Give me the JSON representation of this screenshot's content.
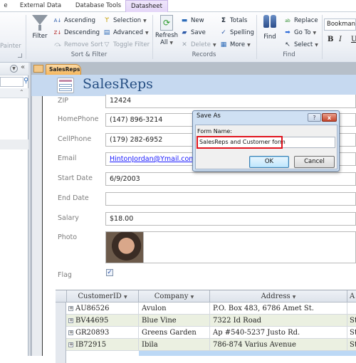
{
  "ribbon_tabs": [
    {
      "label": "e",
      "active": false
    },
    {
      "label": "External Data",
      "active": false
    },
    {
      "label": "Database Tools",
      "active": false
    },
    {
      "label": "Datasheet",
      "active": true
    }
  ],
  "ribbon": {
    "clipboard": {
      "painter": "Painter"
    },
    "sort_filter": {
      "label": "Sort & Filter",
      "filter": "Filter",
      "ascending": "Ascending",
      "descending": "Descending",
      "remove_sort": "Remove Sort",
      "selection": "Selection",
      "advanced": "Advanced",
      "toggle_filter": "Toggle Filter"
    },
    "records": {
      "label": "Records",
      "refresh": "Refresh",
      "refresh_all": "All",
      "new": "New",
      "save": "Save",
      "delete": "Delete",
      "totals": "Totals",
      "spelling": "Spelling",
      "more": "More"
    },
    "find": {
      "label": "Find",
      "find": "Find",
      "replace": "Replace",
      "goto": "Go To",
      "select": "Select"
    },
    "text_formatting": {
      "font": "Bookman O",
      "bold": "B",
      "italic": "I",
      "underline": "U"
    }
  },
  "document_tab": "SalesReps",
  "form": {
    "title": "SalesReps",
    "fields": [
      {
        "label": "ZIP",
        "value": "12424"
      },
      {
        "label": "HomePhone",
        "value": "(147) 896-3214"
      },
      {
        "label": "CellPhone",
        "value": "(179) 282-6952"
      },
      {
        "label": "Email",
        "value": "HintonJordan@Ymail.com"
      },
      {
        "label": "Start Date",
        "value": "6/9/2003"
      },
      {
        "label": "End Date",
        "value": ""
      },
      {
        "label": "Salary",
        "value": "$18.00"
      }
    ],
    "photo_label": "Photo",
    "flag_label": "Flag",
    "flag_checked": true
  },
  "subform": {
    "columns": [
      "CustomerID",
      "Company",
      "Address",
      "A"
    ],
    "rows": [
      {
        "id": "AU86526",
        "company": "Avulon",
        "address": "P.O. Box 483, 6786 Amet St.",
        "extra": ""
      },
      {
        "id": "BV44695",
        "company": "Blue Vine",
        "address": "7322 Id Road",
        "extra": "St"
      },
      {
        "id": "GR20893",
        "company": "Greens Garden",
        "address": "Ap #540-5237 Justo Rd.",
        "extra": "St"
      },
      {
        "id": "IB72915",
        "company": "Ibila",
        "address": "786-874 Varius Avenue",
        "extra": "St"
      }
    ]
  },
  "dialog": {
    "title": "Save As",
    "help": "?",
    "close": "x",
    "field_label": "Form Name:",
    "field_value": "SalesReps and Customer form",
    "ok": "OK",
    "cancel": "Cancel"
  },
  "colors": {
    "accent_tab": "#e4d6f8",
    "form_header": "#c6d9f0",
    "highlight": "#e0141e",
    "row_alt": "#ebf0e1",
    "row_selected": "#bcd8f5"
  }
}
